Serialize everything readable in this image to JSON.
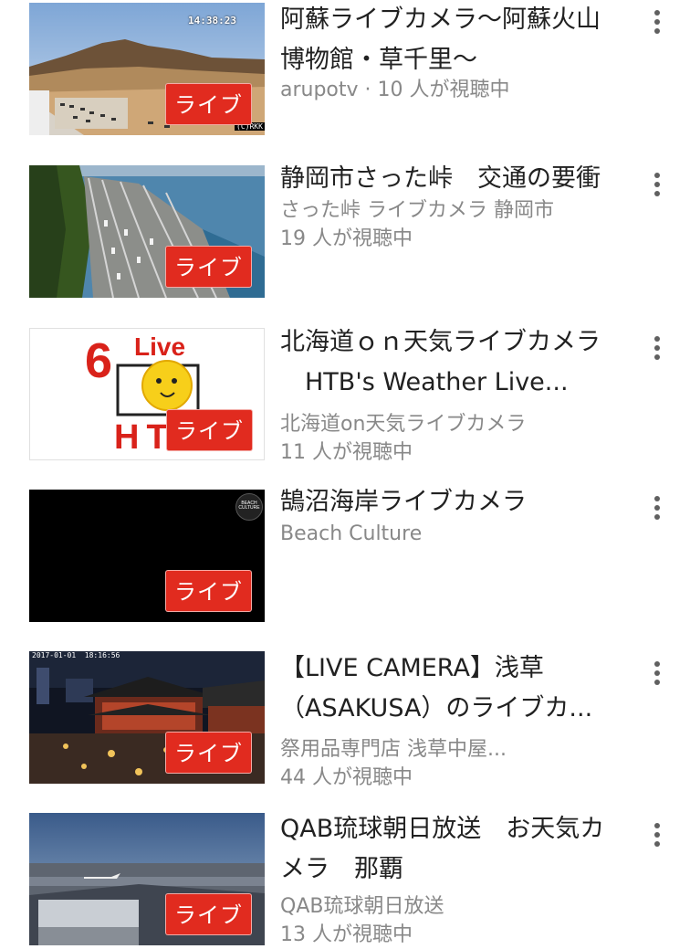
{
  "live_label": "ライブ",
  "videos": [
    {
      "title": "阿蘇ライブカメラ〜阿蘇火山\n博物館・草千里〜",
      "meta": [
        "arupotv · 10 人が視聴中"
      ],
      "thumb_overlay": "14:38:23",
      "thumb_watermark": "(C)RKK"
    },
    {
      "title": "静岡市さった峠　交通の要衝",
      "meta": [
        "さった峠 ライブカメラ 静岡市",
        "19 人が視聴中"
      ]
    },
    {
      "title": "北海道ｏｎ天気ライブカメラ\n　HTB's Weather Live...",
      "meta": [
        "北海道on天気ライブカメラ",
        "11 人が視聴中"
      ],
      "thumb_logo": {
        "number": "6",
        "word": "Live",
        "brand": "HTB"
      }
    },
    {
      "title": "鵠沼海岸ライブカメラ",
      "meta": [
        "Beach Culture"
      ],
      "thumb_logo_text": "BEACH CULTURE"
    },
    {
      "title": "【LIVE CAMERA】浅草\n（ASAKUSA）のライブカ...",
      "meta": [
        "祭用品専門店 浅草中屋...",
        "44 人が視聴中"
      ],
      "thumb_overlay": "2017-01-01  18:16:56"
    },
    {
      "title": "QAB琉球朝日放送　お天気カ\nメラ　那覇",
      "meta": [
        "QAB琉球朝日放送",
        "13 人が視聴中"
      ]
    }
  ],
  "colors": {
    "live_badge": "#e12b1f",
    "title": "#212121",
    "meta": "#888888"
  }
}
